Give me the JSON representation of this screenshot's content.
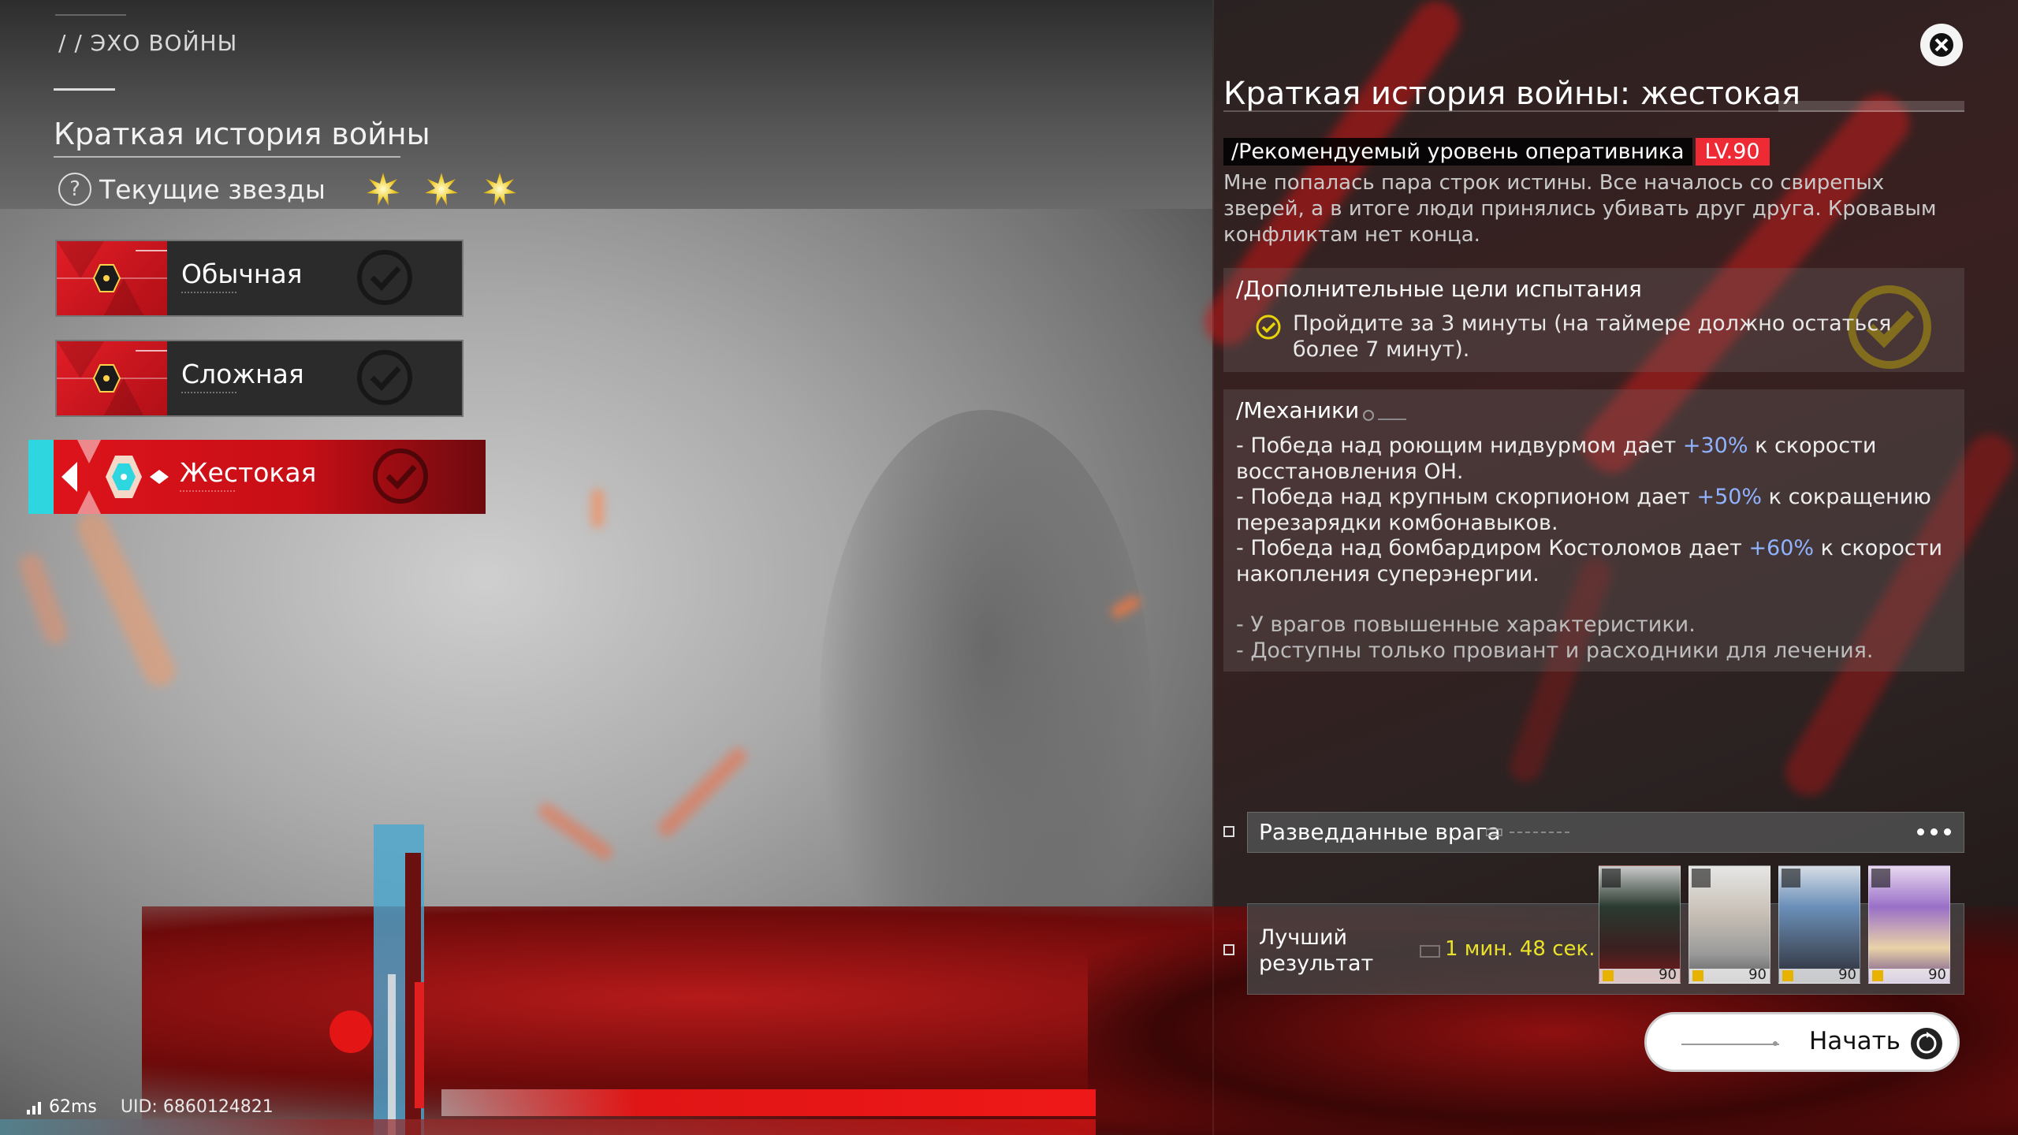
{
  "left": {
    "section_label": "/ / ЭХО ВОЙНЫ",
    "title": "Краткая история войны",
    "stars_label": "Текущие звезды",
    "stars_count": 3,
    "difficulties": [
      {
        "label": "Обычная",
        "active": false
      },
      {
        "label": "Сложная",
        "active": false
      },
      {
        "label": "Жестокая",
        "active": true
      }
    ],
    "ping": "62ms",
    "uid": "UID: 6860124821"
  },
  "right": {
    "title": "Краткая история войны: жестокая",
    "level_label": "/Рекомендуемый уровень оперативника",
    "level_value": "LV.90",
    "description": "Мне попалась пара строк истины. Все началось со свирепых зверей, а в итоге люди принялись убивать друг друга. Кровавым конфликтам нет конца.",
    "goals_header": "/Дополнительные цели испытания",
    "goal_text": "Пройдите за 3 минуты (на таймере должно остаться более 7 минут).",
    "mechanics_header": "/Механики",
    "mechanics": [
      {
        "pre": "- Победа над роющим нидвурмом дает ",
        "hl": "+30%",
        "post": " к скорости восстановления ОН."
      },
      {
        "pre": "- Победа над крупным скорпионом дает ",
        "hl": "+50%",
        "post": " к сокращению перезарядки комбонавыков."
      },
      {
        "pre": "- Победа над бомбардиром Костоломов дает ",
        "hl": "+60%",
        "post": " к скорости накопления суперэнергии."
      }
    ],
    "notes": [
      "- У врагов повышенные характеристики.",
      "- Доступны только провиант и расходники для лечения."
    ],
    "intel_label": "Разведданные врага",
    "best_label": "Лучший результат",
    "best_time": "1 мин. 48 сек.",
    "team": [
      {
        "level": "90",
        "palette": "dark-haired"
      },
      {
        "level": "90",
        "palette": "silver-haired"
      },
      {
        "level": "90",
        "palette": "blue-haired"
      },
      {
        "level": "90",
        "palette": "purple-haired"
      }
    ],
    "start_label": "Начать"
  },
  "colors": {
    "accent_red": "#e0141c",
    "level_badge": "#ee2a35",
    "highlight_blue": "#8fb3ff",
    "time_yellow": "#e9e12a",
    "active_cyan": "#2ed6e0"
  }
}
